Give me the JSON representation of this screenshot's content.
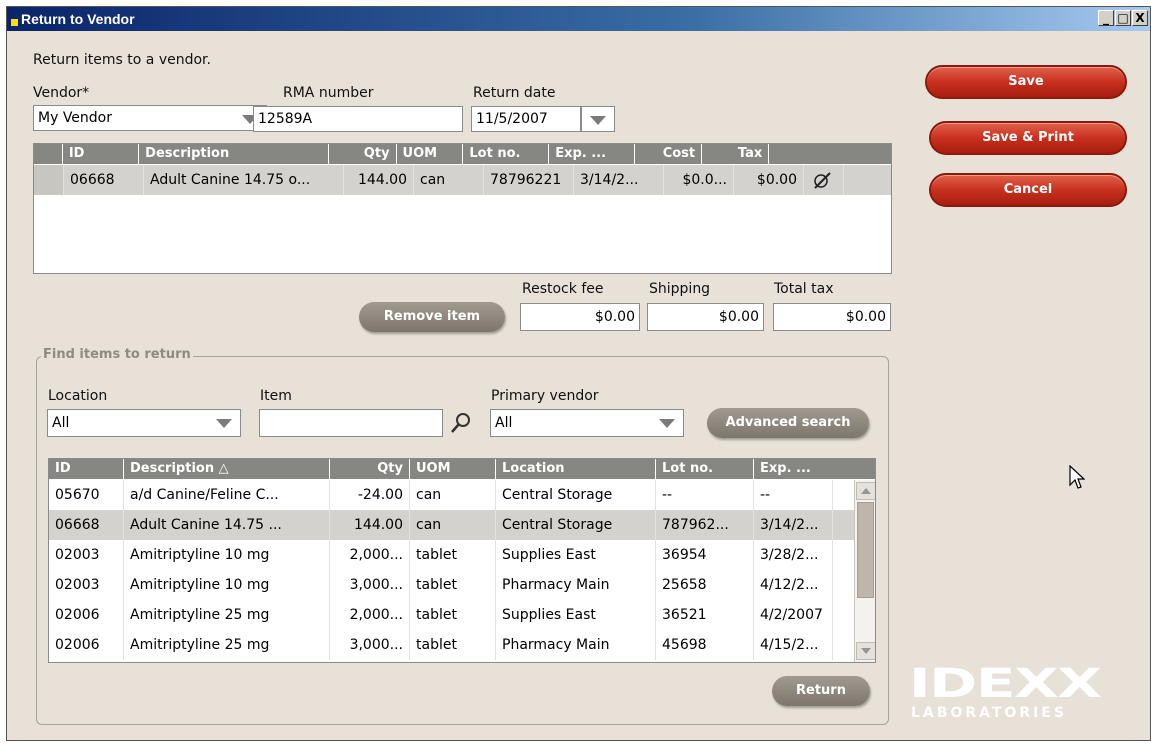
{
  "window": {
    "title": "Return to Vendor",
    "controls": [
      "_",
      "□",
      "X"
    ]
  },
  "header": {
    "description": "Return items to a vendor."
  },
  "vendor": {
    "label": "Vendor*",
    "value": "My Vendor"
  },
  "rma": {
    "label": "RMA number",
    "value": "12589A"
  },
  "return_date": {
    "label": "Return date",
    "value": "11/5/2007"
  },
  "return_grid": {
    "columns": [
      "ID",
      "Description",
      "Qty",
      "UOM",
      "Lot no.",
      "Exp. ...",
      "Cost",
      "Tax"
    ],
    "rows": [
      {
        "id": "06668",
        "description": "Adult Canine 14.75 o...",
        "qty": "144.00",
        "uom": "can",
        "lot": "78796221",
        "exp": "3/14/2...",
        "cost": "$0.0...",
        "tax": "$0.00",
        "edit_icon": "edit-icon"
      }
    ]
  },
  "totals": {
    "restock_label": "Restock fee",
    "restock_value": "$0.00",
    "shipping_label": "Shipping",
    "shipping_value": "$0.00",
    "tax_label": "Total tax",
    "tax_value": "$0.00"
  },
  "buttons": {
    "save": "Save",
    "save_print": "Save & Print",
    "cancel": "Cancel",
    "remove_item": "Remove item",
    "advanced_search": "Advanced search",
    "return": "Return"
  },
  "find": {
    "legend": "Find items to return",
    "location_label": "Location",
    "location_value": "All",
    "item_label": "Item",
    "item_value": "",
    "search_icon": "magnifier-icon",
    "primary_vendor_label": "Primary vendor",
    "primary_vendor_value": "All"
  },
  "find_grid": {
    "columns": [
      "ID",
      "Description △",
      "Qty",
      "UOM",
      "Location",
      "Lot no.",
      "Exp. ..."
    ],
    "rows": [
      {
        "id": "05670",
        "description": "a/d Canine/Feline C...",
        "qty": "-24.00",
        "uom": "can",
        "location": "Central Storage",
        "lot": "--",
        "exp": "--"
      },
      {
        "id": "06668",
        "description": "Adult Canine 14.75 ...",
        "qty": "144.00",
        "uom": "can",
        "location": "Central Storage",
        "lot": "787962...",
        "exp": "3/14/2..."
      },
      {
        "id": "02003",
        "description": "Amitriptyline 10 mg",
        "qty": "2,000...",
        "uom": "tablet",
        "location": "Supplies East",
        "lot": "36954",
        "exp": "3/28/2..."
      },
      {
        "id": "02003",
        "description": "Amitriptyline 10 mg",
        "qty": "3,000...",
        "uom": "tablet",
        "location": "Pharmacy Main",
        "lot": "25658",
        "exp": "4/12/2..."
      },
      {
        "id": "02006",
        "description": "Amitriptyline 25 mg",
        "qty": "2,000...",
        "uom": "tablet",
        "location": "Supplies East",
        "lot": "36521",
        "exp": "4/2/2007"
      },
      {
        "id": "02006",
        "description": "Amitriptyline 25 mg",
        "qty": "3,000...",
        "uom": "tablet",
        "location": "Pharmacy Main",
        "lot": "45698",
        "exp": "4/15/2..."
      }
    ],
    "selected_row": 1
  },
  "logo": {
    "main": "IDEXX",
    "sub": "LABORATORIES"
  },
  "colors": {
    "accent_red": "#c8301e",
    "header_gray": "#868683",
    "selected_row": "#d3d2cf",
    "window_bg": "#e7e1d8"
  }
}
